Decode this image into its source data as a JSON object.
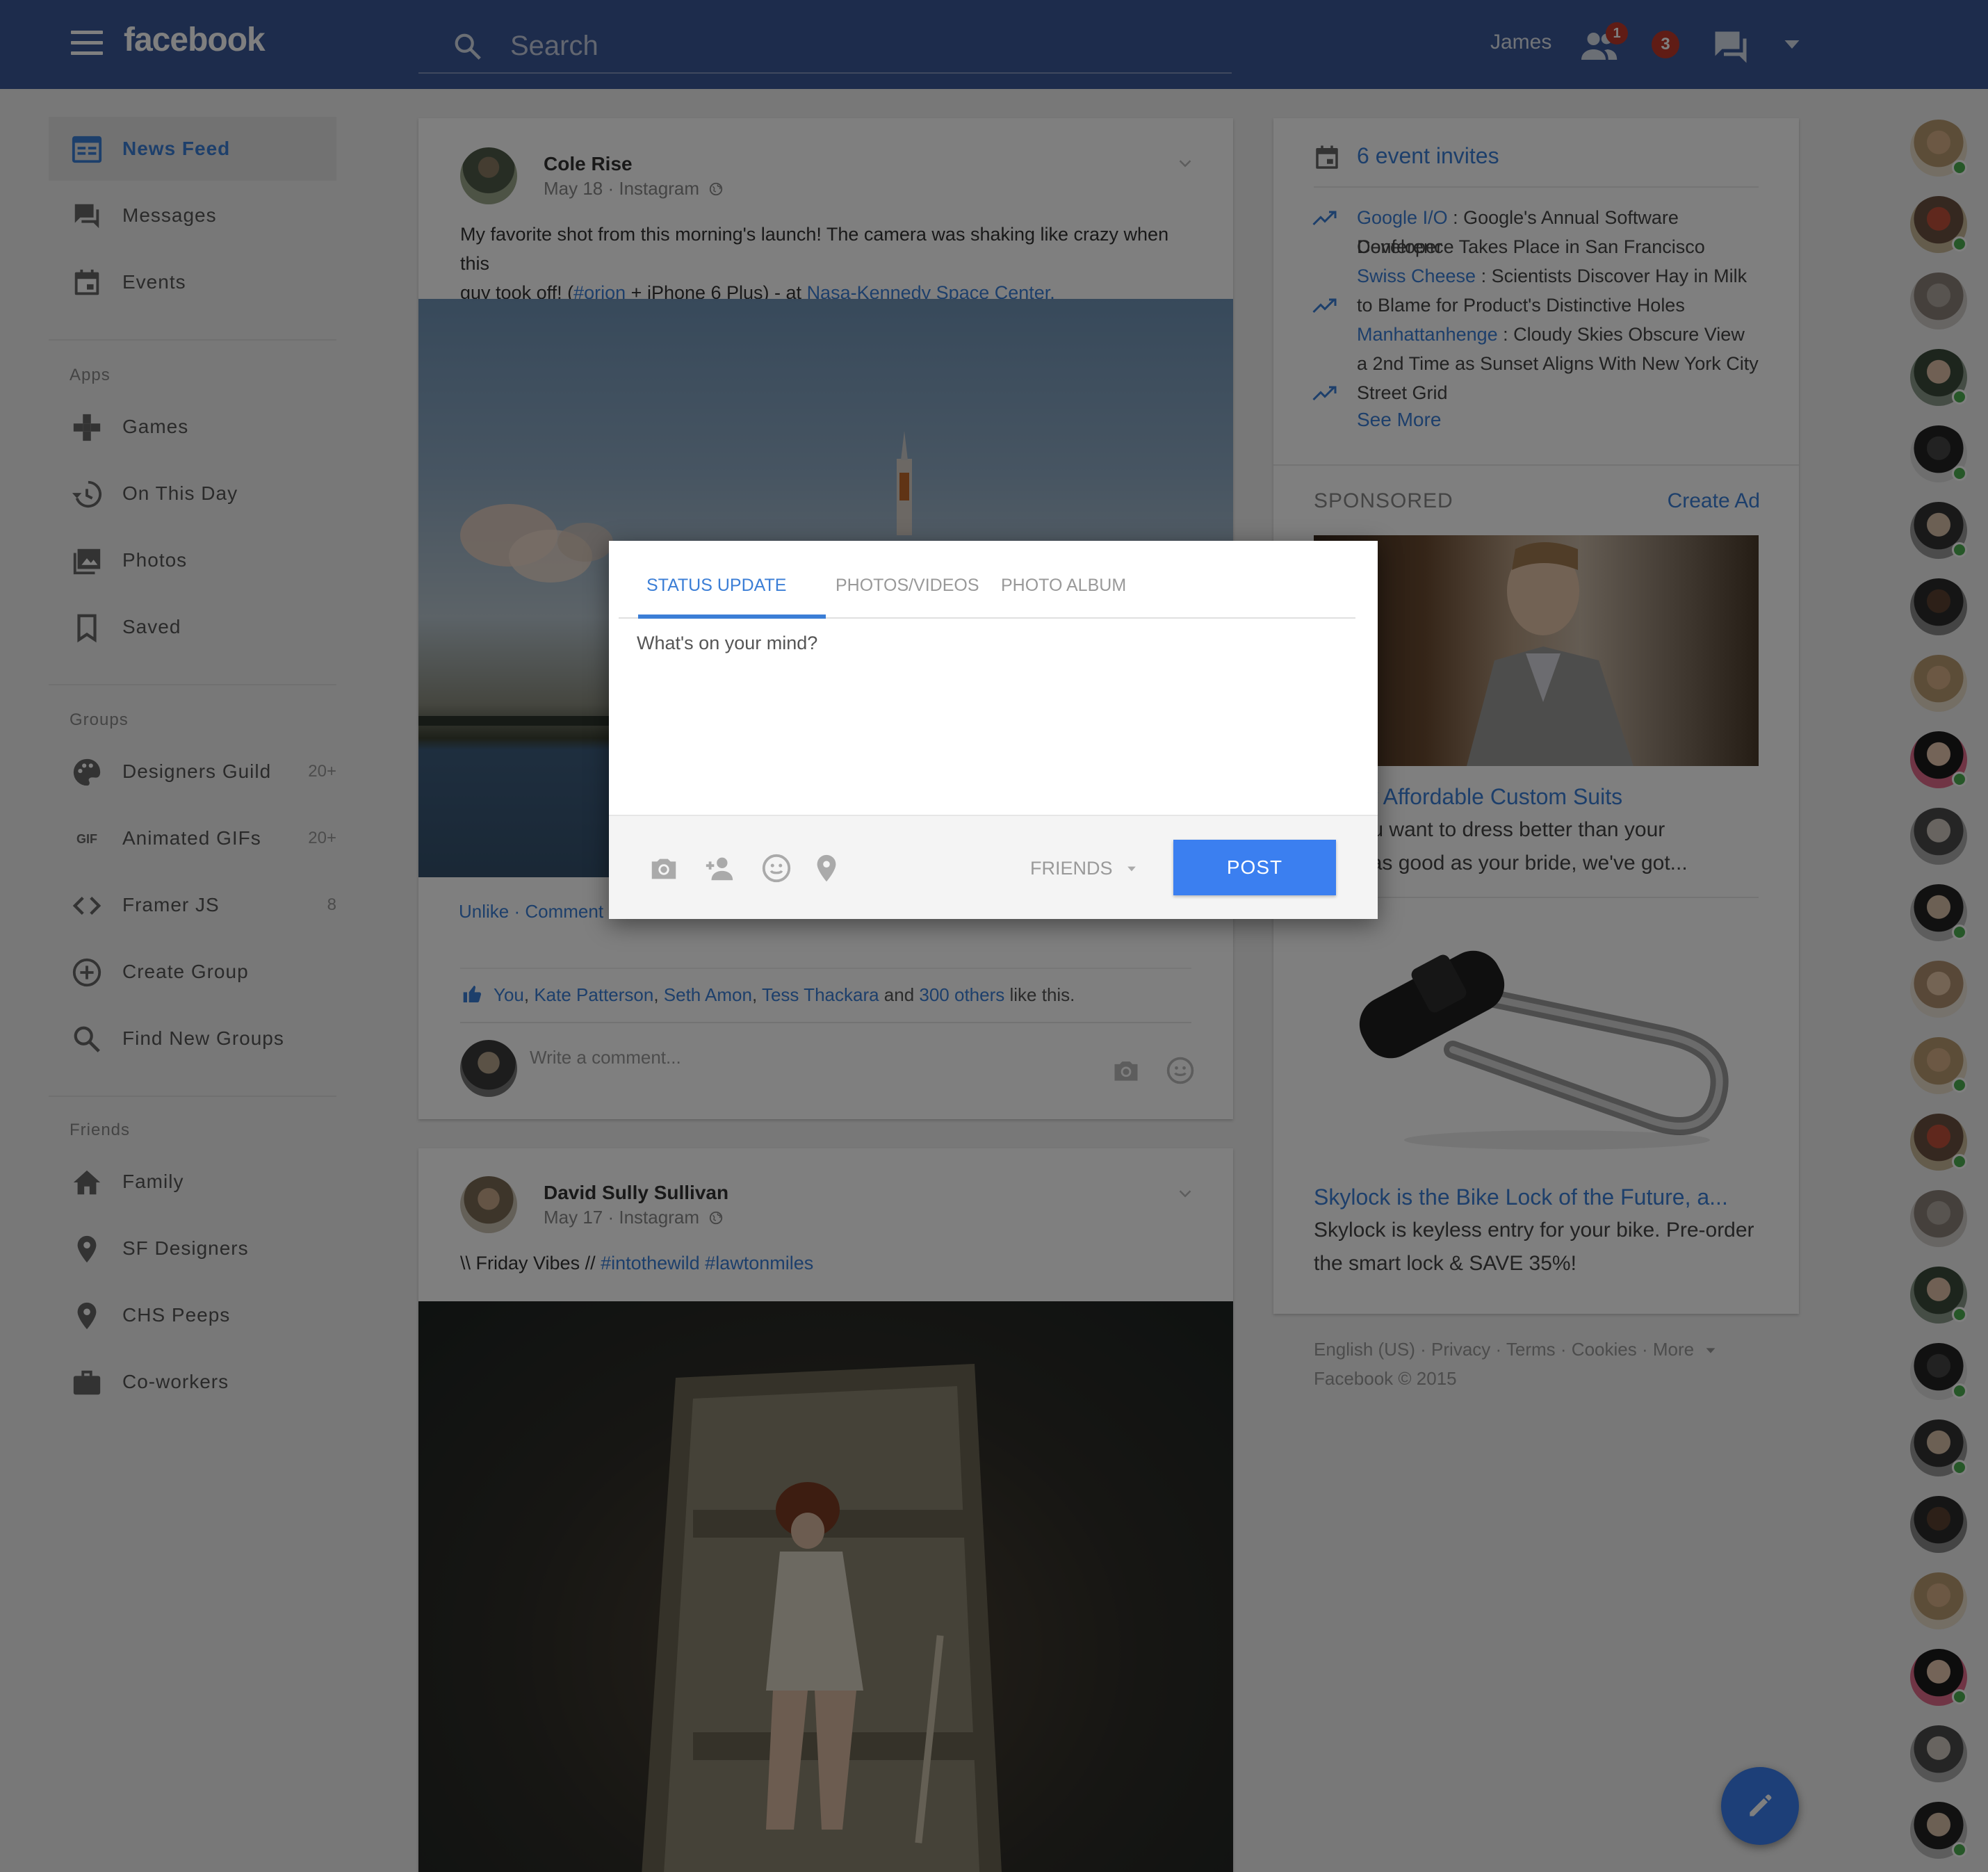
{
  "topbar": {
    "logo": "facebook",
    "search_placeholder": "Search",
    "user_name": "James",
    "friend_requests_badge": "1",
    "notifications_badge": "3"
  },
  "sidebar": {
    "main_items": [
      {
        "label": "News Feed",
        "icon": "newsfeed-icon",
        "active": true
      },
      {
        "label": "Messages",
        "icon": "messages-icon"
      },
      {
        "label": "Events",
        "icon": "events-icon"
      }
    ],
    "apps_title": "Apps",
    "apps": [
      {
        "label": "Games",
        "icon": "gamepad-icon"
      },
      {
        "label": "On This Day",
        "icon": "history-icon"
      },
      {
        "label": "Photos",
        "icon": "photos-icon"
      },
      {
        "label": "Saved",
        "icon": "bookmark-icon"
      }
    ],
    "groups_title": "Groups",
    "groups": [
      {
        "label": "Designers Guild",
        "icon": "palette-icon",
        "count": "20+"
      },
      {
        "label": "Animated GIFs",
        "icon": "gif-icon",
        "count": "20+"
      },
      {
        "label": "Framer JS",
        "icon": "code-icon",
        "count": "8"
      },
      {
        "label": "Create Group",
        "icon": "add-circle-icon",
        "count": ""
      },
      {
        "label": "Find New Groups",
        "icon": "search-icon",
        "count": ""
      }
    ],
    "friends_title": "Friends",
    "friends": [
      {
        "label": "Family",
        "icon": "home-icon"
      },
      {
        "label": "SF Designers",
        "icon": "location-pin-icon"
      },
      {
        "label": "CHS Peeps",
        "icon": "location-pin-icon"
      },
      {
        "label": "Co-workers",
        "icon": "briefcase-icon"
      }
    ],
    "gif_glyph": "GIF"
  },
  "posts": [
    {
      "author": "Cole Rise",
      "meta": "May 18 · Instagram",
      "text_lines": [
        "My favorite shot from this morning's launch! The camera was shaking like crazy when this",
        "guy took off! ("
      ],
      "hashtag": "#orion",
      "text_mid": " + iPhone 6 Plus) - at ",
      "place": "Nasa-Kennedy Space Center.",
      "actions": "Unlike · Comment",
      "likers": [
        "You",
        "Kate Patterson",
        "Seth Amon",
        "Tess Thackara"
      ],
      "likes_and": " and ",
      "likes_others": "300 others",
      "likes_suffix": " like this.",
      "comment_placeholder": "Write a comment..."
    },
    {
      "author": "David Sully Sullivan",
      "meta": "May 17 · Instagram",
      "text": "\\\\ Friday Vibes // ",
      "hashtags": "#intothewild #lawtonmiles"
    }
  ],
  "right": {
    "events_title": "6 event invites",
    "trending": [
      {
        "topic": "Google I/O",
        "lines": [
          " : Google's Annual Software Developer",
          "Conference Takes Place in San Francisco"
        ]
      },
      {
        "topic": "Swiss Cheese",
        "lines": [
          " : Scientists Discover Hay in Milk",
          "to Blame for Product's Distinctive Holes"
        ]
      },
      {
        "topic": "Manhattanhenge",
        "lines": [
          " : Cloudy Skies Obscure View",
          "a 2nd Time as Sunset Aligns With New York City",
          "Street Grid"
        ]
      }
    ],
    "see_more": "See More",
    "sponsored": "SPONSORED",
    "create_ad": "Create Ad",
    "ads": [
      {
        "title": "evably Affordable Custom Suits",
        "body_lines": [
          "er yoou want to dress better than your",
          "r look as good as your bride, we've got..."
        ]
      },
      {
        "title": "Skylock is the Bike Lock of the Future, a...",
        "body_lines": [
          "Skylock is keyless entry for your bike. Pre-order",
          "the smart lock & SAVE 35%!"
        ]
      }
    ],
    "footer_links": "English (US) · Privacy · Terms · Cookies · More",
    "copyright": "Facebook © 2015"
  },
  "modal": {
    "tabs": [
      "STATUS UPDATE",
      "PHOTOS/VIDEOS",
      "PHOTO ALBUM"
    ],
    "placeholder": "What's on your mind?",
    "audience": "FRIENDS",
    "post_label": "POST"
  },
  "colors": {
    "brand": "#3b5998",
    "accent": "#3b7ed6",
    "button": "#3b7ff0",
    "badge": "#c0392b",
    "online": "#4caf50"
  }
}
